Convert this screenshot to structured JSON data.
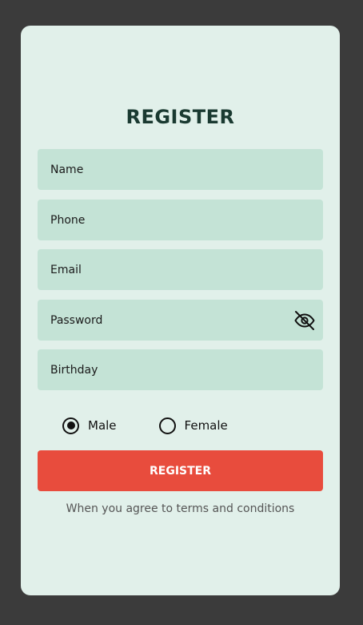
{
  "form": {
    "title": "REGISTER",
    "fields": {
      "name": {
        "placeholder": "Name",
        "value": ""
      },
      "phone": {
        "placeholder": "Phone",
        "value": ""
      },
      "email": {
        "placeholder": "Email",
        "value": ""
      },
      "password": {
        "placeholder": "Password",
        "value": ""
      },
      "birthday": {
        "placeholder": "Birthday",
        "value": ""
      }
    },
    "password_toggle_icon": "eye-off-icon",
    "gender": {
      "options": [
        {
          "label": "Male",
          "selected": true
        },
        {
          "label": "Female",
          "selected": false
        }
      ]
    },
    "submit_label": "REGISTER",
    "terms_text": "When you agree to terms and conditions"
  },
  "colors": {
    "page_background": "#3b3b3b",
    "card_background": "#e1f0ea",
    "field_background": "#c4e3d6",
    "accent": "#e84c3d",
    "title": "#1a3a31"
  }
}
